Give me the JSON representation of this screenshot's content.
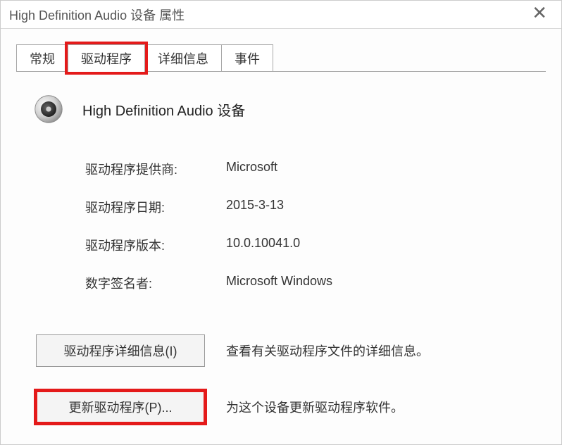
{
  "titlebar": {
    "title": "High Definition Audio 设备 属性"
  },
  "tabs": [
    {
      "label": "常规"
    },
    {
      "label": "驱动程序",
      "active": true
    },
    {
      "label": "详细信息"
    },
    {
      "label": "事件"
    }
  ],
  "device": {
    "name": "High Definition Audio 设备"
  },
  "info": {
    "provider_label": "驱动程序提供商:",
    "provider_value": "Microsoft",
    "date_label": "驱动程序日期:",
    "date_value": "2015-3-13",
    "version_label": "驱动程序版本:",
    "version_value": "10.0.10041.0",
    "signer_label": "数字签名者:",
    "signer_value": "Microsoft Windows"
  },
  "buttons": {
    "details_label": "驱动程序详细信息(I)",
    "details_desc": "查看有关驱动程序文件的详细信息。",
    "update_label": "更新驱动程序(P)...",
    "update_desc": "为这个设备更新驱动程序软件。"
  }
}
